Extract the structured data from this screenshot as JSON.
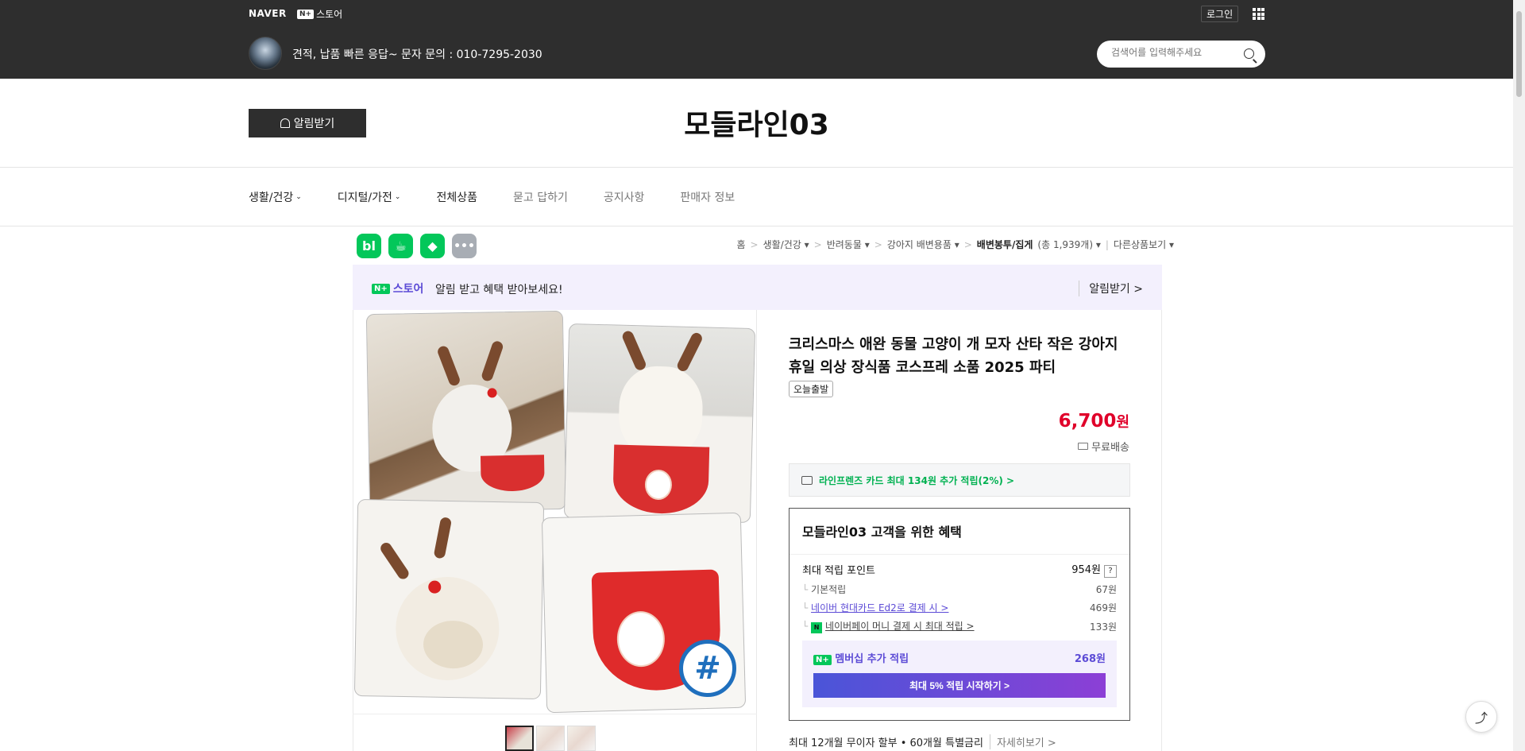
{
  "topbar": {
    "naver_label": "NAVER",
    "nstore_badge": "N+",
    "nstore_label": "스토어",
    "login_label": "로그인",
    "store_description": "견적, 납품 빠른 응답~ 문자 문의 : 010-7295-2030",
    "search_placeholder": "검색어를 입력해주세요"
  },
  "store": {
    "notify_label": "알림받기",
    "title": "모들라인03"
  },
  "nav": {
    "items": [
      {
        "label": "생활/건강",
        "dropdown": "⌄"
      },
      {
        "label": "디지털/가전",
        "dropdown": "⌄"
      },
      {
        "label": "전체상품"
      },
      {
        "label": "묻고 답하기"
      },
      {
        "label": "공지사항"
      },
      {
        "label": "판매자 정보"
      }
    ]
  },
  "share": {
    "icons": [
      "bl",
      "☕",
      "◆",
      "•••"
    ]
  },
  "breadcrumb": {
    "items": [
      "홈",
      "생활/건강 ▾",
      "반려동물 ▾",
      "강아지 배변용품 ▾",
      "배변봉투/집게",
      "(총 1,939개) ▾",
      "다른상품보기 ▾"
    ],
    "sep": ">"
  },
  "banner": {
    "badge": "N+",
    "store": "스토어",
    "text": "알림 받고 혜택 받아보세요!",
    "link": "알림받기 >"
  },
  "product": {
    "title": "크리스마스 애완 동물 고양이 개 모자 산타 작은 강아지 휴일 의상 장식품 코스프레 소품 2025 파티",
    "tag": "오늘출발",
    "price": "6,700",
    "price_unit": "원",
    "shipping": "무료배송",
    "card_offer": "라인프렌즈 카드 최대 134원 추가 적립(2%) >",
    "hash_badge": "#",
    "installment": "최대 12개월 무이자 할부 • 60개월 특별금리",
    "installment_more": "자세히보기 >"
  },
  "benefit": {
    "title": "모들라인03 고객을 위한 혜택",
    "max_points_label": "최대 적립 포인트",
    "max_points_value": "954원",
    "help": "?",
    "rows": [
      {
        "label": "기본적립",
        "value": "67원"
      },
      {
        "label": "네이버 현대카드 Ed2로 결제 시 >",
        "value": "469원"
      },
      {
        "label": "네이버페이 머니 결제 시 최대 적립 >",
        "value": "133원",
        "badge": "N"
      }
    ],
    "member_badge": "N+",
    "member_label": "멤버십 추가 적립",
    "member_value": "268원",
    "member_button": "최대 5% 적립 시작하기 >"
  },
  "float": {
    "share_icon": "⤴"
  },
  "colors": {
    "topbar": "#2e2e2e",
    "price": "#e0002a",
    "naver_green": "#03c75a",
    "purple": "#5c4bd6"
  }
}
